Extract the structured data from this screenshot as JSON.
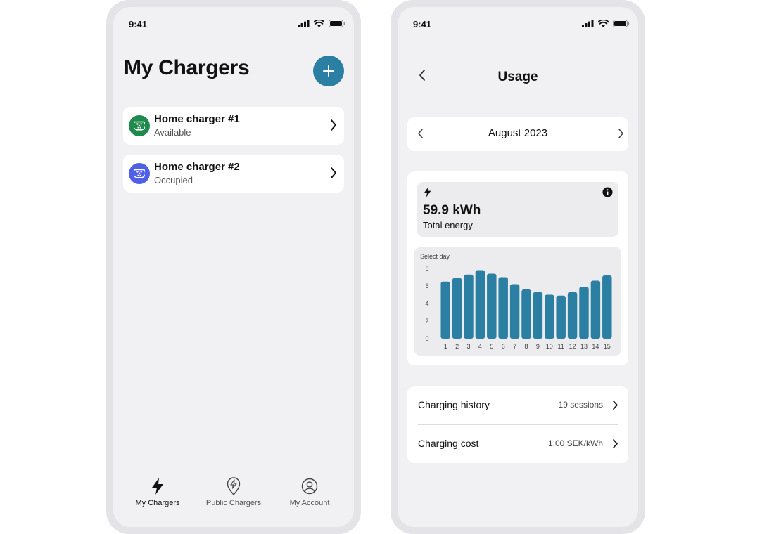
{
  "colors": {
    "accent": "#2a7fa3",
    "available": "#1f8a4c",
    "occupied": "#4f5fe8",
    "bar": "#2a7fa3"
  },
  "left_screen": {
    "status_time": "9:41",
    "title": "My Chargers",
    "add_icon": "plus-icon",
    "chargers": [
      {
        "name": "Home charger #1",
        "status": "Available",
        "icon": "plug-icon",
        "color": "#1f8a4c"
      },
      {
        "name": "Home charger #2",
        "status": "Occupied",
        "icon": "plug-icon",
        "color": "#4f5fe8"
      }
    ],
    "tabs": [
      {
        "label": "My Chargers",
        "icon": "bolt-icon",
        "active": true
      },
      {
        "label": "Public Chargers",
        "icon": "map-pin-bolt-icon",
        "active": false
      },
      {
        "label": "My Account",
        "icon": "user-circle-icon",
        "active": false
      }
    ]
  },
  "right_screen": {
    "status_time": "9:41",
    "title": "Usage",
    "month": "August 2023",
    "energy": {
      "value": "59.9 kWh",
      "caption": "Total energy"
    },
    "chart_label": "Select day",
    "list": [
      {
        "label": "Charging history",
        "value": "19 sessions"
      },
      {
        "label": "Charging cost",
        "value": "1.00 SEK/kWh"
      }
    ]
  },
  "chart_data": {
    "type": "bar",
    "categories": [
      "1",
      "2",
      "3",
      "4",
      "5",
      "6",
      "7",
      "8",
      "9",
      "10",
      "11",
      "12",
      "13",
      "14",
      "15"
    ],
    "values": [
      6.5,
      6.9,
      7.3,
      7.8,
      7.4,
      7.0,
      6.2,
      5.6,
      5.3,
      5.0,
      4.9,
      5.3,
      5.9,
      6.6,
      7.2
    ],
    "yticks": [
      "8",
      "6",
      "4",
      "2",
      "0"
    ],
    "ylim": [
      0,
      8
    ],
    "grid": false
  }
}
